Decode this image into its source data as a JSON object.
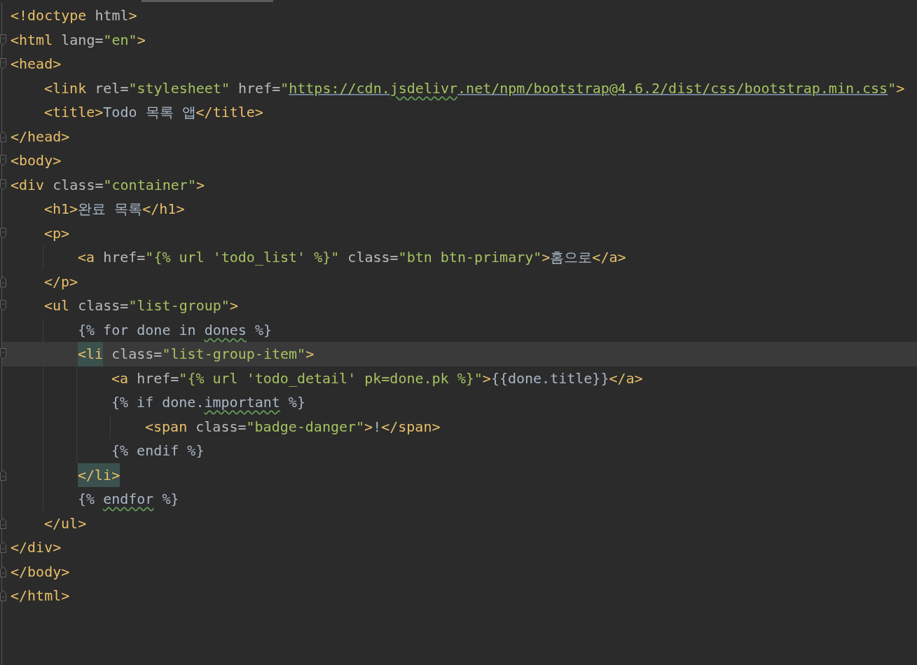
{
  "editor": {
    "lines": [
      {
        "current": false,
        "fold_start": false,
        "fold_end": false,
        "tokens": [
          {
            "kind": "tag",
            "text": "<!doctype"
          },
          {
            "kind": "attr",
            "text": " html"
          },
          {
            "kind": "tag",
            "text": ">"
          }
        ]
      },
      {
        "current": false,
        "fold_start": true,
        "fold_end": false,
        "tokens": [
          {
            "kind": "tag",
            "text": "<html"
          },
          {
            "kind": "attr",
            "text": " lang="
          },
          {
            "kind": "string",
            "text": "\"en\""
          },
          {
            "kind": "tag",
            "text": ">"
          }
        ]
      },
      {
        "current": false,
        "fold_start": true,
        "fold_end": false,
        "tokens": [
          {
            "kind": "tag",
            "text": "<head>"
          }
        ],
        "children": [
          {
            "current": false,
            "fold_start": false,
            "fold_end": false,
            "tokens": [
              {
                "kind": "tag",
                "text": "<link"
              },
              {
                "kind": "attr",
                "text": " rel="
              },
              {
                "kind": "string",
                "text": "\"stylesheet\""
              },
              {
                "kind": "attr",
                "text": " href="
              },
              {
                "kind": "string",
                "text": "\""
              },
              {
                "kind": "url",
                "text": "https://cdn."
              },
              {
                "kind": "url",
                "text": "jsdelivr",
                "typo": true
              },
              {
                "kind": "url",
                "text": ".net/npm/bootstrap@4.6.2/dist/css/bootstrap.min.css"
              },
              {
                "kind": "string",
                "text": "\""
              },
              {
                "kind": "tag",
                "text": ">"
              }
            ]
          },
          {
            "current": false,
            "fold_start": false,
            "fold_end": false,
            "tokens": [
              {
                "kind": "tag",
                "text": "<title>"
              },
              {
                "kind": "text",
                "text": "Todo 목록 앱"
              },
              {
                "kind": "tag",
                "text": "</title>"
              }
            ]
          }
        ]
      },
      {
        "current": false,
        "fold_start": false,
        "fold_end": true,
        "tokens": [
          {
            "kind": "tag",
            "text": "</head>"
          }
        ]
      },
      {
        "current": false,
        "fold_start": true,
        "fold_end": false,
        "tokens": [
          {
            "kind": "tag",
            "text": "<body>"
          }
        ]
      },
      {
        "current": false,
        "fold_start": true,
        "fold_end": false,
        "tokens": [
          {
            "kind": "tag",
            "text": "<div"
          },
          {
            "kind": "attr",
            "text": " class="
          },
          {
            "kind": "string",
            "text": "\"container\""
          },
          {
            "kind": "tag",
            "text": ">"
          }
        ],
        "children": [
          {
            "current": false,
            "fold_start": false,
            "fold_end": false,
            "tokens": [
              {
                "kind": "tag",
                "text": "<h1>"
              },
              {
                "kind": "text",
                "text": "완료 목록"
              },
              {
                "kind": "tag",
                "text": "</h1>"
              }
            ]
          },
          {
            "current": false,
            "fold_start": true,
            "fold_end": false,
            "guide": true,
            "tokens": [
              {
                "kind": "tag",
                "text": "<p>"
              }
            ],
            "children": [
              {
                "current": false,
                "fold_start": false,
                "fold_end": false,
                "tokens": [
                  {
                    "kind": "tag",
                    "text": "<a"
                  },
                  {
                    "kind": "attr",
                    "text": " href="
                  },
                  {
                    "kind": "string",
                    "text": "\"{% url 'todo_list' %}\""
                  },
                  {
                    "kind": "attr",
                    "text": " class="
                  },
                  {
                    "kind": "string",
                    "text": "\"btn btn-primary\""
                  },
                  {
                    "kind": "tag",
                    "text": ">"
                  },
                  {
                    "kind": "text",
                    "text": "홈으로"
                  },
                  {
                    "kind": "tag",
                    "text": "</a>"
                  }
                ]
              }
            ]
          },
          {
            "current": false,
            "fold_start": false,
            "fold_end": true,
            "tokens": [
              {
                "kind": "tag",
                "text": "</p>"
              }
            ]
          },
          {
            "current": false,
            "fold_start": true,
            "fold_end": false,
            "guide": true,
            "tokens": [
              {
                "kind": "tag",
                "text": "<ul"
              },
              {
                "kind": "attr",
                "text": " class="
              },
              {
                "kind": "string",
                "text": "\"list-group\""
              },
              {
                "kind": "tag",
                "text": ">"
              }
            ],
            "children": [
              {
                "current": false,
                "fold_start": false,
                "fold_end": false,
                "tokens": [
                  {
                    "kind": "text",
                    "text": "{% for done in "
                  },
                  {
                    "kind": "text",
                    "text": "dones",
                    "typo": true
                  },
                  {
                    "kind": "text",
                    "text": " %}"
                  }
                ]
              },
              {
                "current": true,
                "fold_start": true,
                "fold_end": false,
                "guide": true,
                "tokens": [
                  {
                    "kind": "tag",
                    "text": "<li",
                    "matched": true
                  },
                  {
                    "kind": "attr",
                    "text": " class="
                  },
                  {
                    "kind": "string",
                    "text": "\"list-group-item\""
                  },
                  {
                    "kind": "tag",
                    "text": ">"
                  }
                ],
                "children": [
                  {
                    "current": false,
                    "fold_start": false,
                    "fold_end": false,
                    "tokens": [
                      {
                        "kind": "tag",
                        "text": "<a"
                      },
                      {
                        "kind": "attr",
                        "text": " href="
                      },
                      {
                        "kind": "string",
                        "text": "\"{% url 'todo_detail' pk=done.pk %}\""
                      },
                      {
                        "kind": "tag",
                        "text": ">"
                      },
                      {
                        "kind": "text",
                        "text": "{{done.title}}"
                      },
                      {
                        "kind": "tag",
                        "text": "</a>"
                      }
                    ]
                  },
                  {
                    "current": false,
                    "fold_start": false,
                    "fold_end": false,
                    "guide": true,
                    "tokens": [
                      {
                        "kind": "text",
                        "text": "{% if done."
                      },
                      {
                        "kind": "text",
                        "text": "important",
                        "typo": true
                      },
                      {
                        "kind": "text",
                        "text": " %}"
                      }
                    ],
                    "children": [
                      {
                        "current": false,
                        "fold_start": false,
                        "fold_end": false,
                        "tokens": [
                          {
                            "kind": "tag",
                            "text": "<span"
                          },
                          {
                            "kind": "attr",
                            "text": " class="
                          },
                          {
                            "kind": "string",
                            "text": "\"badge-danger\""
                          },
                          {
                            "kind": "tag",
                            "text": ">"
                          },
                          {
                            "kind": "text",
                            "text": "!"
                          },
                          {
                            "kind": "tag",
                            "text": "</span>"
                          }
                        ]
                      }
                    ]
                  },
                  {
                    "current": false,
                    "fold_start": false,
                    "fold_end": false,
                    "tokens": [
                      {
                        "kind": "text",
                        "text": "{% endif %}"
                      }
                    ]
                  }
                ]
              },
              {
                "current": false,
                "fold_start": false,
                "fold_end": true,
                "tokens": [
                  {
                    "kind": "tag",
                    "text": "</li>",
                    "matched": true
                  }
                ]
              },
              {
                "current": false,
                "fold_start": false,
                "fold_end": false,
                "tokens": [
                  {
                    "kind": "text",
                    "text": "{% "
                  },
                  {
                    "kind": "text",
                    "text": "endfor",
                    "typo": true
                  },
                  {
                    "kind": "text",
                    "text": " %}"
                  }
                ]
              }
            ]
          },
          {
            "current": false,
            "fold_start": false,
            "fold_end": true,
            "tokens": [
              {
                "kind": "tag",
                "text": "</ul>"
              }
            ]
          }
        ]
      },
      {
        "current": false,
        "fold_start": false,
        "fold_end": true,
        "tokens": [
          {
            "kind": "tag",
            "text": "</div>"
          }
        ]
      },
      {
        "current": false,
        "fold_start": false,
        "fold_end": true,
        "tokens": [
          {
            "kind": "tag",
            "text": "</body>"
          }
        ]
      },
      {
        "current": false,
        "fold_start": false,
        "fold_end": true,
        "tokens": [
          {
            "kind": "tag",
            "text": "</html>"
          }
        ]
      }
    ]
  }
}
